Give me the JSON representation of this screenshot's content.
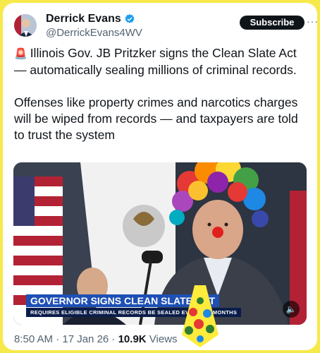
{
  "author": {
    "name": "Derrick Evans",
    "handle": "@DerrickEvans4WV",
    "verified": true,
    "avatar": "avatar"
  },
  "header": {
    "subscribe_label": "Subscribe",
    "more_icon": "more-icon"
  },
  "tweet": {
    "siren": "🚨",
    "paragraph1": "Illinois Gov. JB Pritzker signs the Clean Slate Act — automatically sealing millions of criminal records.",
    "paragraph2": "Offenses like property crimes and narcotics charges will be wiped from records — and taxpayers are told to trust the system"
  },
  "media": {
    "chyron_title": "GOVERNOR SIGNS CLEAN SLATE ACT",
    "chyron_subtitle": "REQUIRES ELIGIBLE CRIMINAL RECORDS BE SEALED EVERY SIX MONTHS",
    "sound_icon": "mute-icon"
  },
  "footer": {
    "time_date": "8:50 AM · 17 Jan 26 · ",
    "views_count": "10.9K",
    "views_label": "Views"
  },
  "colors": {
    "page_bg": "#f7e94a",
    "accent": "#1d9bf0",
    "chyron_blue": "#1d4fb5"
  }
}
